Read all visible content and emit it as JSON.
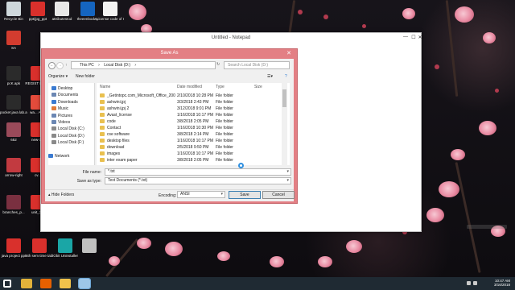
{
  "desktop": {
    "icons": [
      {
        "label": "Recycle Bin",
        "name": "recycle-bin-icon",
        "color": "#cfd8dc"
      },
      {
        "label": "ppt/jpg_ppt",
        "name": "pdf-file-icon",
        "color": "#d9302c"
      },
      {
        "label": "attributestod",
        "name": "document-file-icon",
        "color": "#e8e8e8"
      },
      {
        "label": "theeenbodwy",
        "name": "mail-app-icon",
        "color": "#1565c0"
      },
      {
        "label": "License code of IObit Uni...",
        "name": "text-file-icon",
        "color": "#f2f2f2"
      },
      {
        "label": "SA",
        "name": "folder-icon",
        "color": "#d33c2f"
      },
      {
        "label": "pcK.apk",
        "name": "apk-file-icon",
        "color": "#2b2b2b"
      },
      {
        "label": "REGIST FORM",
        "name": "pdf-file-icon",
        "color": "#d9302c"
      },
      {
        "label": "pocket java lab.apk",
        "name": "apk-file-icon",
        "color": "#2b2b2b"
      },
      {
        "label": "wa... Ap...",
        "name": "apk-file-icon",
        "color": "#e34b3b"
      },
      {
        "label": "652",
        "name": "image-file-icon",
        "color": "#9a4a5a"
      },
      {
        "label": "new-1...",
        "name": "pdf-file-icon",
        "color": "#d9302c"
      },
      {
        "label": "arrow-right",
        "name": "image-file-icon",
        "color": "#c23a40"
      },
      {
        "label": "cv...",
        "name": "pdf-file-icon",
        "color": "#d9302c"
      },
      {
        "label": "branches_p...",
        "name": "image-file-icon",
        "color": "#7a3040"
      },
      {
        "label": "unit_3...",
        "name": "pdf-file-icon",
        "color": "#d9302c"
      },
      {
        "label": "java project ppt",
        "name": "pdf-file-icon",
        "color": "#d9302c"
      },
      {
        "label": "6th sem time table",
        "name": "pdf-file-icon",
        "color": "#d9302c"
      },
      {
        "label": "IObit Uninstaller",
        "name": "iobit-app-icon",
        "color": "#1aa6a6"
      },
      {
        "label": "",
        "name": "image-file-icon",
        "color": "#c0c0c0"
      }
    ]
  },
  "notepad": {
    "title": "Untitled - Notepad",
    "controls": {
      "minimize": "—",
      "maximize": "☐",
      "close": "✕"
    }
  },
  "dialog": {
    "title": "Save As",
    "close": "✕",
    "nav": {
      "back": "←",
      "forward": "→",
      "up": "↑"
    },
    "breadcrumb": [
      "This PC",
      "›",
      "Local Disk (D:)",
      "›"
    ],
    "search_placeholder": "Search Local Disk (D:)",
    "organize": "Organize ▾",
    "new_folder": "New folder",
    "tree": [
      {
        "label": "Desktop",
        "color": "#3b7bd1"
      },
      {
        "label": "Documents",
        "color": "#6b87b3"
      },
      {
        "label": "Downloads",
        "color": "#3b7bd1"
      },
      {
        "label": "Music",
        "color": "#e07b39"
      },
      {
        "label": "Pictures",
        "color": "#6b87b3"
      },
      {
        "label": "Videos",
        "color": "#6b87b3"
      },
      {
        "label": "Local Disk (C:)",
        "color": "#8a8a8a"
      },
      {
        "label": "Local Disk (D:)",
        "color": "#8a8a8a"
      },
      {
        "label": "Local Disk (F:)",
        "color": "#8a8a8a"
      },
      {
        "label": "",
        "color": "#ffffff"
      },
      {
        "label": "Network",
        "color": "#3b7bd1"
      }
    ],
    "columns": {
      "name": "Name",
      "date": "Date modified",
      "type": "Type",
      "size": "Size"
    },
    "files": [
      {
        "name": "_Getintopc.com_Microsoft_Office_2007_E...",
        "date": "2/10/2018 10:28 PM",
        "type": "File folder"
      },
      {
        "name": "ashwini.jpj",
        "date": "3/3/2018 2:43 PM",
        "type": "File folder"
      },
      {
        "name": "ashwini.jpj 2",
        "date": "3/12/2018 9:01 PM",
        "type": "File folder"
      },
      {
        "name": "Avast_license",
        "date": "1/16/2018 10:17 PM",
        "type": "File folder"
      },
      {
        "name": "code",
        "date": "3/8/2018 2:05 PM",
        "type": "File folder"
      },
      {
        "name": "Contact",
        "date": "1/16/2018 10:30 PM",
        "type": "File folder"
      },
      {
        "name": "cse software",
        "date": "3/8/2018 2:14 PM",
        "type": "File folder"
      },
      {
        "name": "desktop files",
        "date": "1/16/2018 10:17 PM",
        "type": "File folder"
      },
      {
        "name": "download",
        "date": "2/5/2018 9:50 PM",
        "type": "File folder"
      },
      {
        "name": "images",
        "date": "1/16/2018 10:17 PM",
        "type": "File folder"
      },
      {
        "name": "inter exam paper",
        "date": "3/8/2018 2:05 PM",
        "type": "File folder"
      }
    ],
    "file_name_label": "File name:",
    "file_name_value": "*.txt",
    "save_type_label": "Save as type:",
    "save_type_value": "Text Documents (*.txt)",
    "hide_folders": "Hide Folders",
    "encoding_label": "Encoding:",
    "encoding_value": "ANSI",
    "save": "Save",
    "cancel": "Cancel"
  },
  "taskbar": {
    "apps": [
      {
        "name": "start-button-icon",
        "color": "#ffffff"
      },
      {
        "name": "chrome-icon",
        "color": "#e2b23a"
      },
      {
        "name": "firefox-icon",
        "color": "#e66000"
      },
      {
        "name": "file-explorer-icon",
        "color": "#f0c24b"
      },
      {
        "name": "notepad-icon",
        "color": "#9ec7e8"
      }
    ],
    "time": "10:47 AM",
    "date": "3/16/2018"
  }
}
